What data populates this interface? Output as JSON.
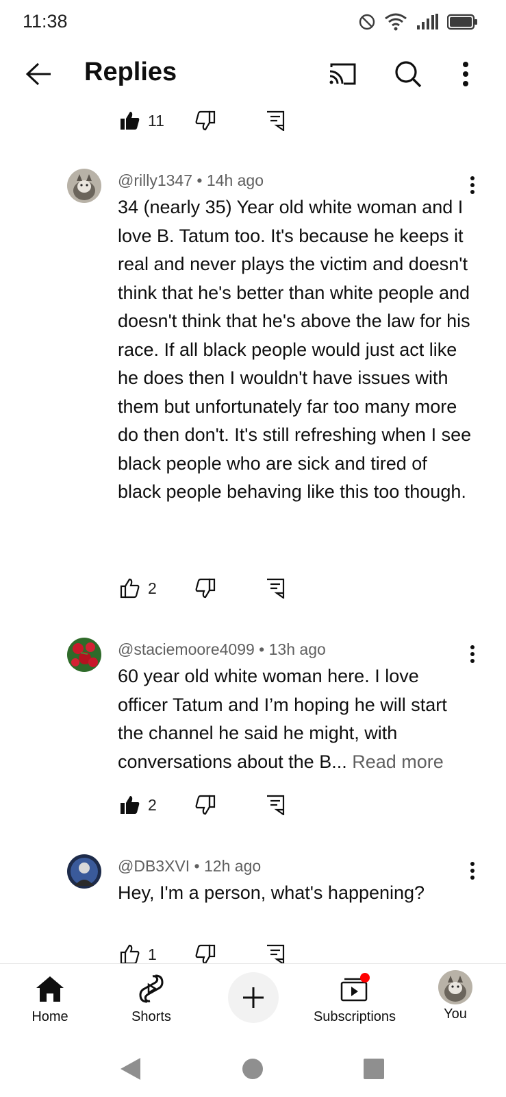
{
  "status": {
    "time": "11:38"
  },
  "header": {
    "title": "Replies"
  },
  "top_actions": {
    "like_count": "11"
  },
  "comments": [
    {
      "author": "@rilly1347",
      "separator": " • ",
      "time": "14h ago",
      "text": "34 (nearly 35) Year old white woman and I love B. Tatum too. It's because he keeps it real and never plays the victim and doesn't think that he's better than white people and doesn't think that he's above the law for his race. If all black people would just act like he does then I wouldn't have issues with them but unfortunately far too many more do then don't. It's still refreshing when I see black people who are sick and tired of black people behaving like this too though.",
      "likes": "2",
      "liked": false
    },
    {
      "author": "@staciemoore4099",
      "separator": " • ",
      "time": "13h ago",
      "text": "60 year old white woman here. I love officer Tatum and I’m hoping he will start the channel he said he might, with conversations about the B... ",
      "read_more": "Read more",
      "likes": "2",
      "liked": true
    },
    {
      "author": "@DB3XVI",
      "separator": " • ",
      "time": "12h ago",
      "text": "Hey, I'm a person, what's happening?",
      "likes": "1",
      "liked": false
    }
  ],
  "bottom_nav": {
    "home": "Home",
    "shorts": "Shorts",
    "subscriptions": "Subscriptions",
    "you": "You"
  },
  "colors": {
    "notification_dot": "#ff0000",
    "secondary_text": "#606060"
  }
}
